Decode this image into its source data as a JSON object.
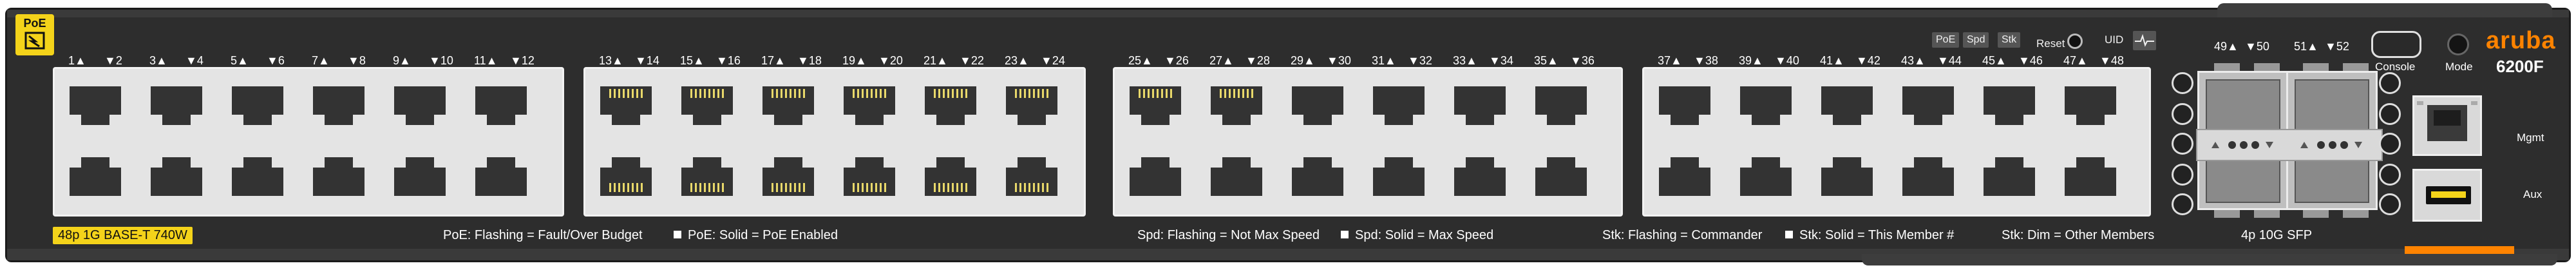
{
  "badges": {
    "poe_logo": "PoE",
    "ports_summary": "48p 1G BASE-T 740W"
  },
  "port_groups": [
    {
      "numbers_left": [
        "1▲",
        "▼2",
        "3▲",
        "▼4",
        "5▲",
        "▼6",
        "7▲",
        "▼8",
        "9▲",
        "▼10",
        "11▲",
        "▼12"
      ]
    },
    {
      "numbers_left": [
        "13▲",
        "▼14",
        "15▲",
        "▼16",
        "17▲",
        "▼18",
        "19▲",
        "▼20",
        "21▲",
        "▼22",
        "23▲",
        "▼24"
      ]
    },
    {
      "numbers_left": [
        "25▲",
        "▼26",
        "27▲",
        "▼28",
        "29▲",
        "▼30",
        "31▲",
        "▼32",
        "33▲",
        "▼34",
        "35▲",
        "▼36"
      ]
    },
    {
      "numbers_left": [
        "37▲",
        "▼38",
        "39▲",
        "▼40",
        "41▲",
        "▼42",
        "43▲",
        "▼44",
        "45▲",
        "▼46",
        "47▲",
        "▼48"
      ]
    }
  ],
  "legend": {
    "poe_flashing": "PoE: Flashing = Fault/Over Budget",
    "poe_solid": "PoE: Solid = PoE Enabled",
    "spd_flashing": "Spd: Flashing = Not Max Speed",
    "spd_solid": "Spd: Solid = Max Speed",
    "stk_flashing": "Stk: Flashing = Commander",
    "stk_solid": "Stk: Solid = This Member #",
    "stk_dim": "Stk: Dim = Other Members"
  },
  "controls": {
    "poe": "PoE",
    "spd": "Spd",
    "stk": "Stk",
    "reset": "Reset",
    "uid": "UID"
  },
  "sfp": {
    "numbers": [
      "49▲",
      "▼50",
      "51▲",
      "▼52"
    ],
    "label": "4p 10G SFP"
  },
  "right_panel": {
    "console": "Console",
    "mode": "Mode",
    "brand": "aruba",
    "model": "6200F",
    "mgmt": "Mgmt",
    "aux": "Aux"
  },
  "colors": {
    "chassis": "#2d2d2d",
    "accent_yellow": "#f4d31a",
    "brand_orange": "#ff8300",
    "poe_contacts": "#e8d86a"
  },
  "icons": [
    "poe-logo-icon",
    "reset-pinhole-icon",
    "uid-pulse-icon",
    "rj45-port-icon",
    "usb-port-icon"
  ]
}
